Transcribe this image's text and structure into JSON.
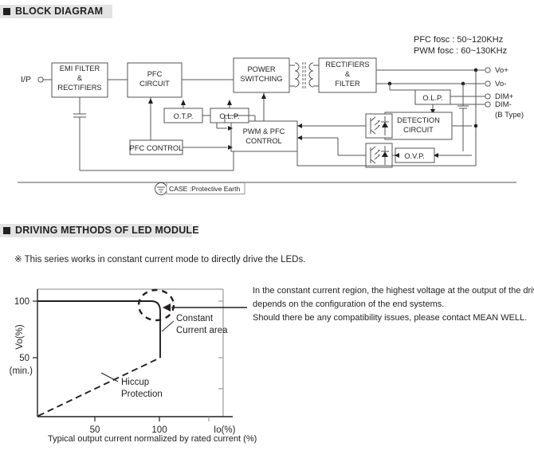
{
  "sections": {
    "block_diagram": {
      "title": "BLOCK DIAGRAM"
    },
    "driving_methods": {
      "title": "DRIVING METHODS OF LED MODULE"
    }
  },
  "block_diagram": {
    "fosc_note_line1": "PFC fosc : 50~120KHz",
    "fosc_note_line2": "PWM fosc : 60~130KHz",
    "input_label": "I/P",
    "blocks": {
      "emi_filter": [
        "EMI FILTER",
        "&",
        "RECTIFIERS"
      ],
      "pfc_circuit": [
        "PFC",
        "CIRCUIT"
      ],
      "power_switching": [
        "POWER",
        "SWITCHING"
      ],
      "rectifiers_filter": [
        "RECTIFIERS",
        "&",
        "FILTER"
      ],
      "otp": "O.T.P.",
      "olp_left": "O.L.P.",
      "olp_right": "O.L.P.",
      "pfc_control": "PFC CONTROL",
      "pwm_pfc_control": [
        "PWM & PFC",
        "CONTROL"
      ],
      "detection_circuit": [
        "DETECTION",
        "CIRCUIT"
      ],
      "ovp": "O.V.P."
    },
    "earth_label": "CASE :Protective Earth",
    "outputs": [
      {
        "label": "Vo+"
      },
      {
        "label": "Vo-"
      },
      {
        "label": "DIM+"
      },
      {
        "label": "DIM-"
      }
    ],
    "output_note": "(B Type)"
  },
  "driving_methods": {
    "note": "※ This series works in constant current mode to directly drive the LEDs.",
    "right_text_line1": "In the constant current region, the highest voltage at the output of the driver",
    "right_text_line2": "depends on the configuration of the end systems.",
    "right_text_line3": "Should there be any compatibility issues, please contact MEAN WELL.",
    "caption": "Typical output current normalized by rated current (%)"
  },
  "chart_data": {
    "type": "line",
    "title": "",
    "xlabel": "Io(%)",
    "ylabel": "Vo(%)",
    "xlim": [
      0,
      140
    ],
    "ylim": [
      0,
      115
    ],
    "grid": false,
    "xticks": [
      {
        "value": 50,
        "label": "50"
      },
      {
        "value": 100,
        "label": "100"
      },
      {
        "value": 135,
        "label": "Io(%)"
      }
    ],
    "yticks": [
      {
        "value": 100,
        "label": "100"
      },
      {
        "value": 50,
        "label": "50"
      },
      {
        "value": 43,
        "label": "(min.)"
      }
    ],
    "series": [
      {
        "name": "Constant Current area",
        "style": "solid",
        "points": [
          [
            0,
            100
          ],
          [
            88,
            100
          ],
          [
            97,
            99
          ],
          [
            100,
            92
          ],
          [
            100,
            50
          ]
        ]
      },
      {
        "name": "Hiccup Protection",
        "style": "dashed",
        "points": [
          [
            0,
            0
          ],
          [
            100,
            50
          ]
        ]
      }
    ],
    "annotations": [
      {
        "name": "constant-current-area",
        "text": [
          "Constant",
          "Current area"
        ]
      },
      {
        "name": "hiccup-protection",
        "text": [
          "Hiccup",
          "Protection"
        ]
      },
      {
        "name": "highlight-circle",
        "shape": "dashed-ellipse"
      },
      {
        "name": "callout-arrow",
        "shape": "arrow-left"
      }
    ]
  }
}
